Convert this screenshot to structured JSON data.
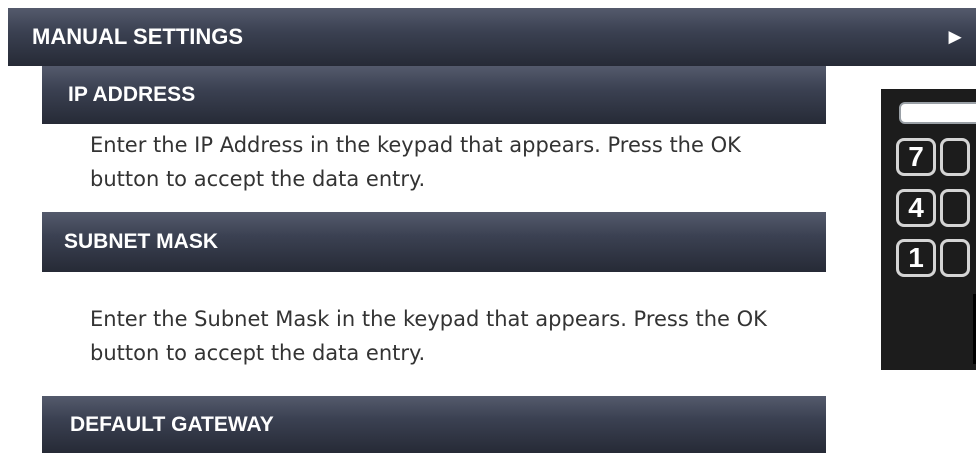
{
  "header": {
    "title": "MANUAL SETTINGS",
    "arrow": "►"
  },
  "sections": [
    {
      "heading": "IP ADDRESS",
      "text": "Enter the IP Address in the keypad that appears. Press the OK button to accept the data entry."
    },
    {
      "heading": "SUBNET MASK",
      "text": "Enter the Subnet Mask in the keypad that appears. Press the OK button to accept the data entry."
    },
    {
      "heading": "DEFAULT GATEWAY"
    }
  ],
  "keypad": {
    "keys": [
      "7",
      "4",
      "1"
    ]
  },
  "colors": {
    "bar_dark": "#262a36",
    "bar_light": "#545a6c",
    "body_text": "#333333",
    "keypad_bg": "#1c1c1c"
  }
}
